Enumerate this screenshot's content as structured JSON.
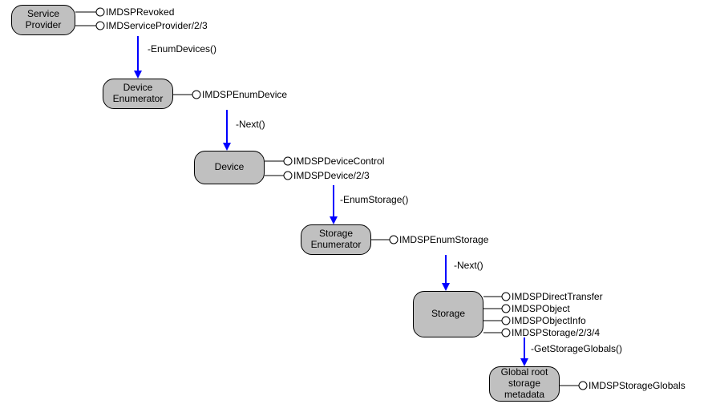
{
  "nodes": {
    "service_provider": "Service\nProvider",
    "device_enumerator": "Device\nEnumerator",
    "device": "Device",
    "storage_enumerator": "Storage\nEnumerator",
    "storage": "Storage",
    "global_root": "Global root\nstorage\nmetadata"
  },
  "interfaces": {
    "sp1": "IMDSPRevoked",
    "sp2": "IMDServiceProvider/2/3",
    "de1": "IMDSPEnumDevice",
    "dv1": "IMDSPDeviceControl",
    "dv2": "IMDSPDevice/2/3",
    "se1": "IMDSPEnumStorage",
    "st1": "IMDSPDirectTransfer",
    "st2": "IMDSPObject",
    "st3": "IMDSPObjectInfo",
    "st4": "IMDSPStorage/2/3/4",
    "gr1": "IMDSPStorageGlobals"
  },
  "methods": {
    "m1": "-EnumDevices()",
    "m2": "-Next()",
    "m3": "-EnumStorage()",
    "m4": "-Next()",
    "m5": "-GetStorageGlobals()"
  }
}
